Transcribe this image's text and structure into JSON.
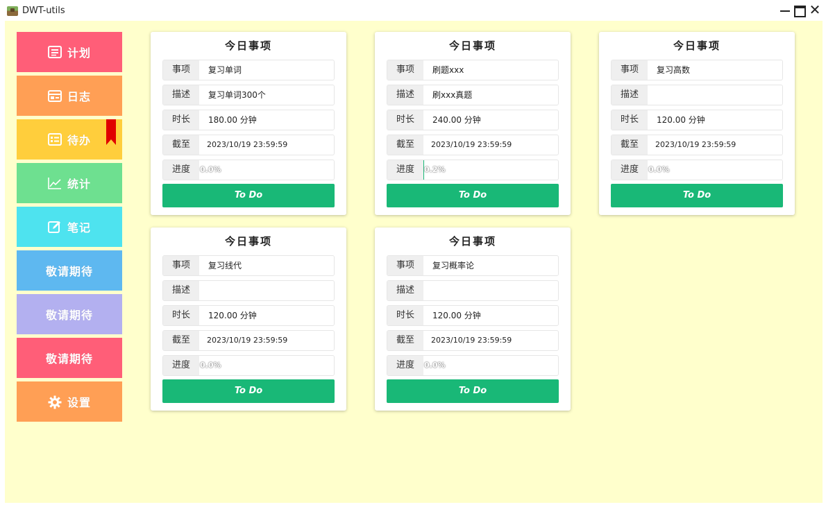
{
  "window": {
    "title": "DWT-utils",
    "close_glyph": "✕"
  },
  "sidebar": {
    "items": [
      {
        "label": "计划",
        "icon": "list-icon",
        "color": "#ff5e78"
      },
      {
        "label": "日志",
        "icon": "calendar-icon",
        "color": "#ff9f55"
      },
      {
        "label": "待办",
        "icon": "checklist-icon",
        "color": "#ffce3c",
        "bookmark_color": "#e00000"
      },
      {
        "label": "统计",
        "icon": "chart-line-icon",
        "color": "#6ee090"
      },
      {
        "label": "笔记",
        "icon": "edit-icon",
        "color": "#4ee3ef"
      },
      {
        "label": "敬请期待",
        "icon": "",
        "color": "#5eb8f0"
      },
      {
        "label": "敬请期待",
        "icon": "",
        "color": "#b3b0f0"
      },
      {
        "label": "敬请期待",
        "icon": "",
        "color": "#ff5e78"
      },
      {
        "label": "设置",
        "icon": "gear-icon",
        "color": "#ff9f55"
      }
    ]
  },
  "labels": {
    "card_title": "今日事项",
    "item": "事项",
    "desc": "描述",
    "duration": "时长",
    "deadline": "截至",
    "progress": "进度",
    "button": "To Do"
  },
  "cards": [
    {
      "item": "复习单词",
      "desc": "复习单词300个",
      "duration": "180.00 分钟",
      "deadline": "2023/10/19 23:59:59",
      "progress_text": "0.0%",
      "progress": 0.0
    },
    {
      "item": "刷题xxx",
      "desc": "刷xxx真题",
      "duration": "240.00 分钟",
      "deadline": "2023/10/19 23:59:59",
      "progress_text": "0.2%",
      "progress": 0.002
    },
    {
      "item": "复习高数",
      "desc": "",
      "duration": "120.00 分钟",
      "deadline": "2023/10/19 23:59:59",
      "progress_text": "0.0%",
      "progress": 0.0
    },
    {
      "item": "复习线代",
      "desc": "",
      "duration": "120.00 分钟",
      "deadline": "2023/10/19 23:59:59",
      "progress_text": "0.0%",
      "progress": 0.0
    },
    {
      "item": "复习概率论",
      "desc": "",
      "duration": "120.00 分钟",
      "deadline": "2023/10/19 23:59:59",
      "progress_text": "0.0%",
      "progress": 0.0
    }
  ],
  "colors": {
    "accent": "#19b877",
    "background": "#ffffcc"
  }
}
